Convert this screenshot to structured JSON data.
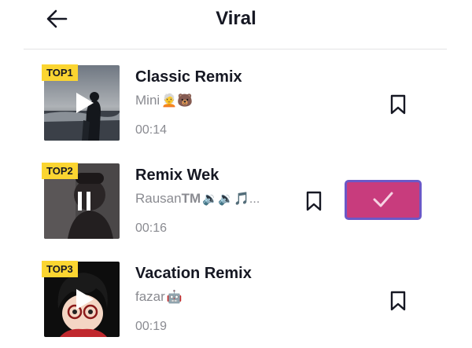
{
  "header": {
    "title": "Viral"
  },
  "tracks": [
    {
      "rank": "TOP1",
      "name": "Classic Remix",
      "artist": "Mini",
      "artist_emoji": "🧑‍🦳🐻",
      "duration": "00:14",
      "state": "play"
    },
    {
      "rank": "TOP2",
      "name": "Remix Wek",
      "artist": "Rausan",
      "artist_tm": "TM",
      "artist_emoji": "🔉🔉🎵...",
      "duration": "00:16",
      "state": "playing"
    },
    {
      "rank": "TOP3",
      "name": "Vacation Remix",
      "artist": "fazar",
      "artist_emoji": "🤖",
      "duration": "00:19",
      "state": "play"
    }
  ],
  "icons": {
    "back": "arrow-left-icon",
    "bookmark": "bookmark-icon",
    "confirm": "checkmark-icon",
    "play": "play-icon",
    "pause": "pause-icon"
  },
  "colors": {
    "confirm_button": "#c83c7d",
    "confirm_border": "#6b58c7",
    "rank_badge": "#fbd531",
    "secondary_text": "#8a8b91"
  }
}
